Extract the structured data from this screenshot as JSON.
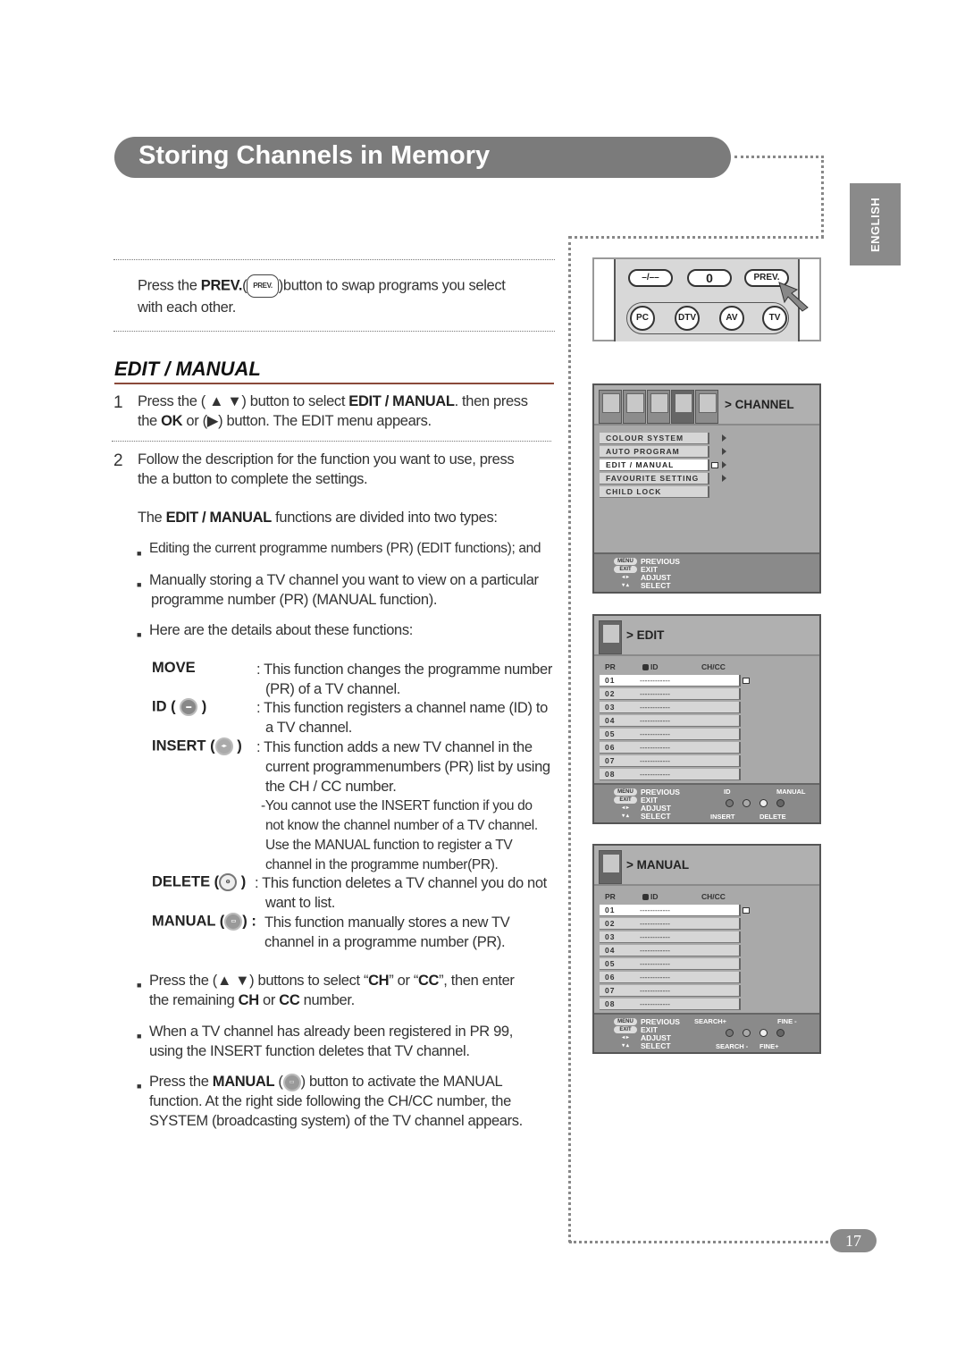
{
  "header": {
    "title": "Storing Channels in Memory",
    "language_tab": "ENGLISH"
  },
  "prev_note": {
    "l1_pre": "Press the ",
    "l1_bold": "PREV.",
    "l1_paren": "(",
    "icon_label": "PREV.",
    "l1_post": ")button to swap programs you select",
    "l2": "with each other."
  },
  "section": {
    "title": "EDIT / MANUAL"
  },
  "step1": {
    "num": "1",
    "l1_a": "Press the (",
    "l1_b": ") button to select ",
    "l1_bold": "EDIT / MANUAL",
    "l1_c": ". then press",
    "l2_a": "the ",
    "l2_ok": "OK",
    "l2_b": " or (",
    "l2_c": ") button. The EDIT menu appears."
  },
  "step2": {
    "num": "2",
    "l1": "Follow the description for the function you want to use, press",
    "l2": "the a button to complete the settings."
  },
  "types": {
    "pre": "The ",
    "bold": "EDIT / MANUAL",
    "post": " functions are divided into two types:"
  },
  "bullets": {
    "b1": "Editing the current programme numbers (PR) (EDIT functions); and",
    "b2_l1": "Manually storing a TV channel you want to view on a particular",
    "b2_l2": "programme number (PR) (MANUAL function).",
    "b3": "Here are the details about these functions:"
  },
  "functions": {
    "move": {
      "term": "MOVE",
      "l1": ": This function changes the programme number",
      "l2": "(PR) of a TV channel."
    },
    "id": {
      "term": "ID (",
      "term_end": ")",
      "l1": ": This function registers a channel name (ID) to",
      "l2": "a TV channel."
    },
    "insert": {
      "term": "INSERT (",
      "term_end": ")",
      "l1": ": This function adds a new TV channel in the",
      "l2": "current programmenumbers (PR) list by using",
      "l3": "the CH / CC number.",
      "l4": "-You cannot use the INSERT function if you do",
      "l5": "not know the channel number of a TV channel.",
      "l6": "Use the MANUAL function to register a TV",
      "l7": "channel in the programme number(PR)."
    },
    "delete": {
      "term": "DELETE (",
      "term_end": ")",
      "l1": ": This function deletes a TV channel you do not",
      "l2": "want to list."
    },
    "manual": {
      "term": "MANUAL (",
      "term_end": ") :",
      "l1": "This function manually stores a new TV",
      "l2": "channel in a programme number (PR)."
    }
  },
  "bullets2": {
    "b4_a": "Press the (",
    "b4_b": ") buttons to select “",
    "b4_ch": "CH",
    "b4_c": "” or “",
    "b4_cc": "CC",
    "b4_d": "”, then enter",
    "b4_l2_a": "the remaining ",
    "b4_l2_ch": "CH",
    "b4_l2_b": " or ",
    "b4_l2_cc": "CC",
    "b4_l2_c": " number.",
    "b5_l1": "When a TV channel has already been registered in PR 99,",
    "b5_l2": "using the INSERT function deletes that TV channel.",
    "b6_a": "Press the ",
    "b6_bold": "MANUAL",
    "b6_b": " (",
    "b6_c": ") button to activate the MANUAL",
    "b6_l2": "function. At the right side following the CH/CC number, the",
    "b6_l3": "SYSTEM (broadcasting system) of the TV channel appears."
  },
  "remote": {
    "buttons": [
      "–/––",
      "0",
      "PREV."
    ],
    "sources": [
      "PC",
      "DTV",
      "AV",
      "TV"
    ]
  },
  "channel_menu": {
    "title": "CHANNEL",
    "items": [
      {
        "label": "COLOUR SYSTEM",
        "arrow": true
      },
      {
        "label": "AUTO PROGRAM",
        "arrow": true
      },
      {
        "label": "EDIT / MANUAL",
        "arrow": true,
        "selected": true
      },
      {
        "label": "FAVOURITE SETTING",
        "arrow": true
      },
      {
        "label": "CHILD LOCK",
        "arrow": false
      }
    ]
  },
  "footer_keys": {
    "menu": "MENU",
    "exit": "EXIT",
    "previous": "PREVIOUS",
    "exit_label": "EXIT",
    "adjust": "ADJUST",
    "select": "SELECT"
  },
  "edit_menu": {
    "title": "EDIT",
    "cols": [
      "PR",
      "ID",
      "CH/CC"
    ],
    "rows": [
      "01",
      "02",
      "03",
      "04",
      "05",
      "06",
      "07",
      "08"
    ],
    "placeholder": "------------",
    "labels": {
      "id": "ID",
      "manual": "MANUAL",
      "insert": "INSERT",
      "delete": "DELETE"
    }
  },
  "manual_menu": {
    "title": "MANUAL",
    "cols": [
      "PR",
      "ID",
      "CH/CC"
    ],
    "rows": [
      "01",
      "02",
      "03",
      "04",
      "05",
      "06",
      "07",
      "08"
    ],
    "placeholder": "------------",
    "labels": {
      "search_plus": "SEARCH+",
      "fine_minus": "FINE -",
      "search_minus": "SEARCH -",
      "fine_plus": "FINE+"
    }
  },
  "page_number": "17"
}
